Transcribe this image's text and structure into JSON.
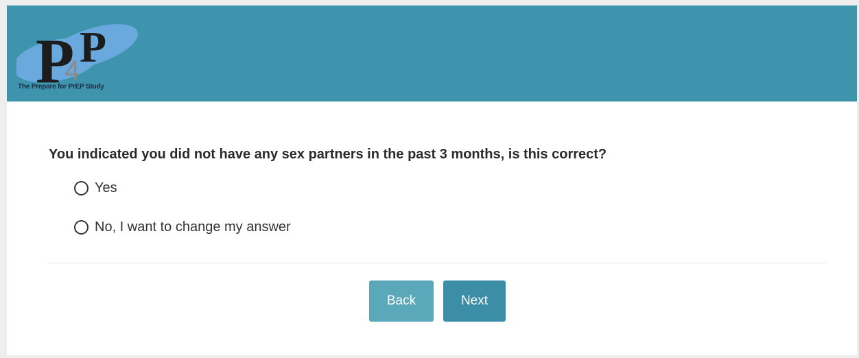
{
  "colors": {
    "header_bg": "#3d94ac",
    "back_button": "#5aa8b9",
    "next_button": "#3b8ea5"
  },
  "header": {
    "logo_text": "P4P",
    "logo_tagline": "The Prepare for PrEP Study"
  },
  "question": {
    "text": "You indicated you did not have any sex partners in the past 3 months, is this correct?",
    "options": [
      {
        "label": "Yes",
        "selected": false
      },
      {
        "label": "No, I want to change my answer",
        "selected": false
      }
    ]
  },
  "buttons": {
    "back": "Back",
    "next": "Next"
  }
}
